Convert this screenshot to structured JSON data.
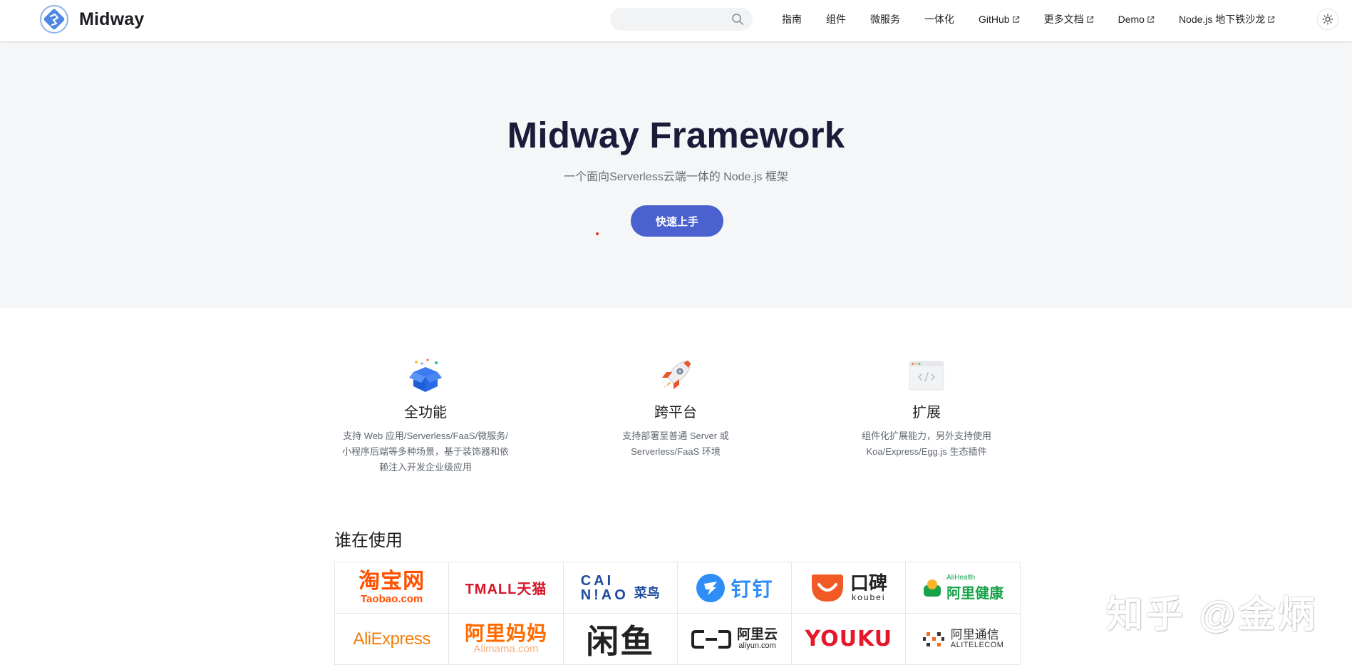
{
  "brand": {
    "name": "Midway"
  },
  "search": {
    "placeholder": ""
  },
  "nav": {
    "items": [
      {
        "label": "指南",
        "external": false
      },
      {
        "label": "组件",
        "external": false
      },
      {
        "label": "微服务",
        "external": false
      },
      {
        "label": "一体化",
        "external": false
      },
      {
        "label": "GitHub",
        "external": true
      },
      {
        "label": "更多文档",
        "external": true
      },
      {
        "label": "Demo",
        "external": true
      },
      {
        "label": "Node.js 地下铁沙龙",
        "external": true
      }
    ]
  },
  "hero": {
    "title": "Midway Framework",
    "subtitle": "一个面向Serverless云端一体的 Node.js 框架",
    "cta_label": "快速上手"
  },
  "features": [
    {
      "icon": "gift-box-icon",
      "title": "全功能",
      "desc_lines": [
        "支持 Web 应用/Serverless/FaaS/微服务/",
        "小程序后端等多种场景，基于装饰器和依",
        "赖注入开发企业级应用"
      ]
    },
    {
      "icon": "rocket-icon",
      "title": "跨平台",
      "desc_lines": [
        "支持部署至普通 Server 或",
        "Serverless/FaaS 环境"
      ]
    },
    {
      "icon": "code-window-icon",
      "title": "扩展",
      "desc_lines": [
        "组件化扩展能力，另外支持使用",
        "Koa/Express/Egg.js 生态插件"
      ]
    }
  ],
  "users": {
    "heading": "谁在使用",
    "logos": {
      "taobao": {
        "line1": "淘宝网",
        "line2": "Taobao.com"
      },
      "tmall": {
        "text": "TMALL天猫"
      },
      "cainiao": {
        "line1": "CAI",
        "line2": "N!AO",
        "cn": "菜鸟"
      },
      "dingtalk": {
        "text": "钉钉"
      },
      "koubei": {
        "line1": "口碑",
        "line2": "koubei"
      },
      "alihealth": {
        "line1": "AliHealth",
        "line2": "阿里健康"
      },
      "aliexpress": {
        "text": "AliExpress"
      },
      "alimama": {
        "line1": "阿里妈妈",
        "line2": "Alimama.com"
      },
      "xianyu": {
        "text": "闲鱼"
      },
      "aliyun": {
        "line1": "阿里云",
        "line2": "aliyun.com"
      },
      "youku": {
        "text": "YOUKU"
      },
      "alitelecom": {
        "line1": "阿里通信",
        "line2": "ALITELECOM"
      }
    }
  },
  "watermark": {
    "text": "知乎 @金炳"
  },
  "colors": {
    "accent": "#4a61cf",
    "hero_bg": "#f5f6f7",
    "title": "#1b1b3a"
  }
}
